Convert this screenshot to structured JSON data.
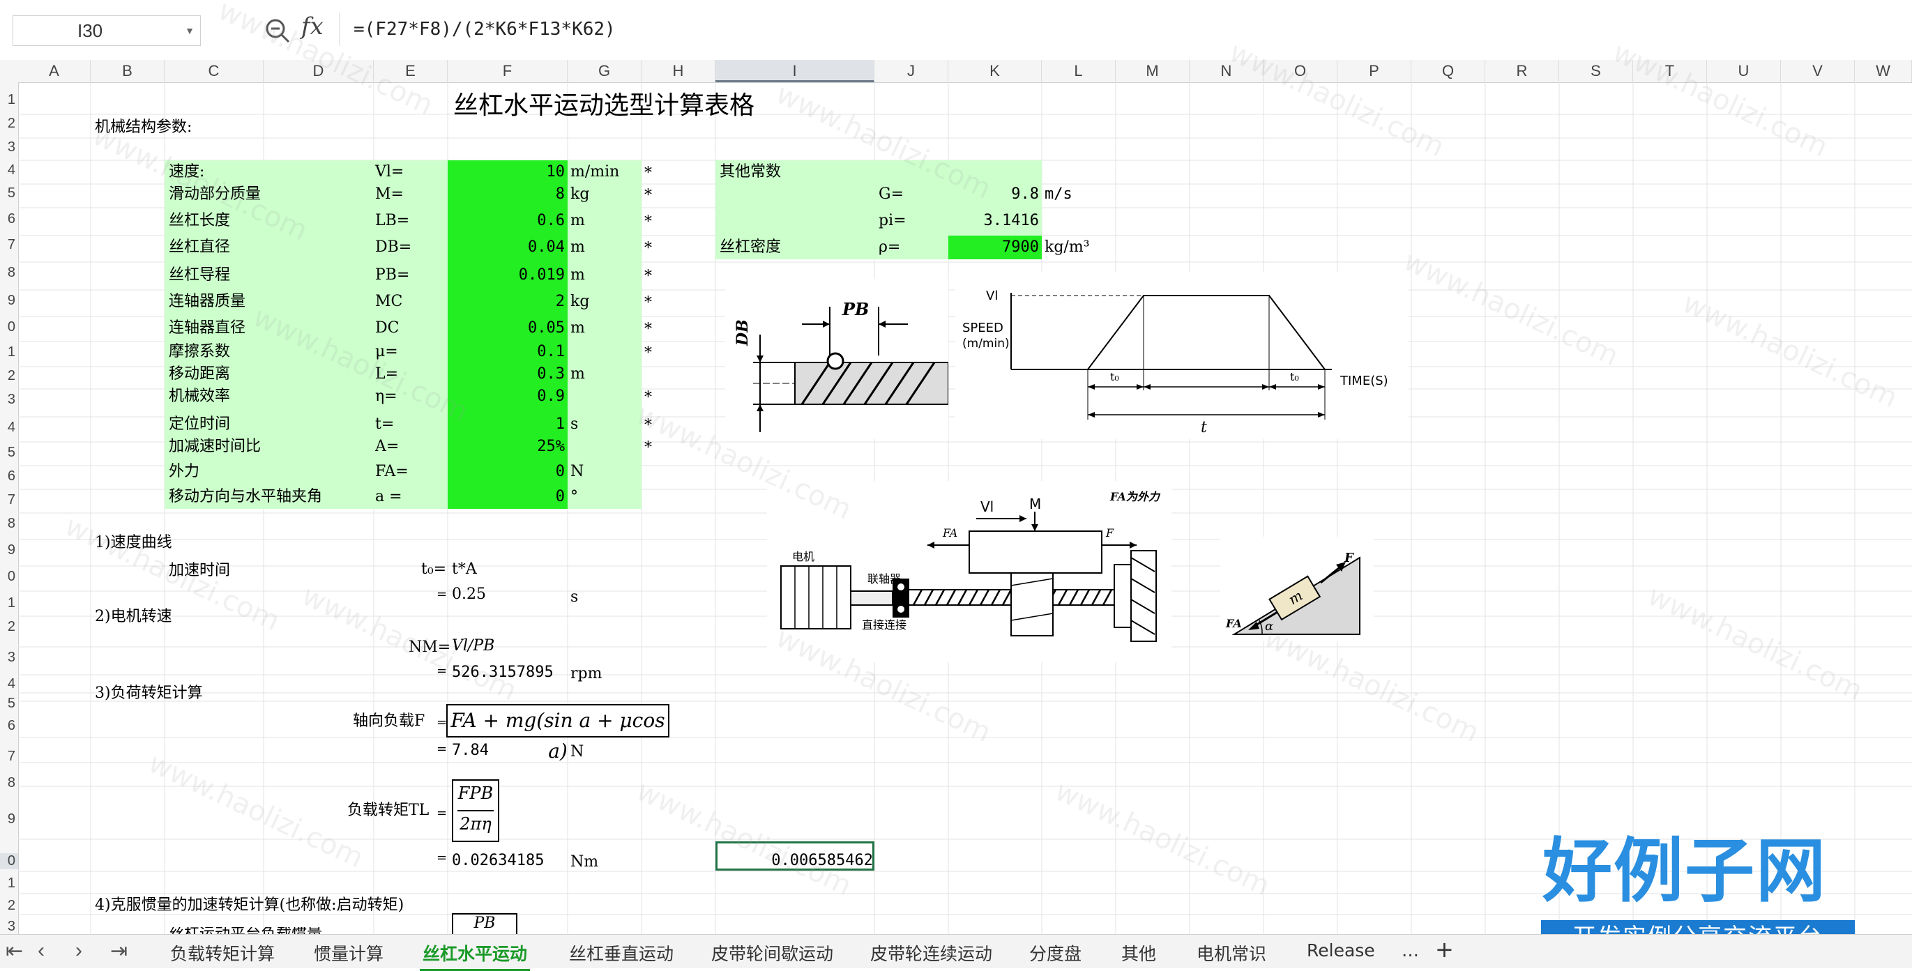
{
  "formula_bar": {
    "name_box": "I30",
    "fx_label": "fx",
    "formula": "=(F27*F8)/(2*K6*F13*K62)"
  },
  "columns": [
    "A",
    "B",
    "C",
    "D",
    "E",
    "F",
    "G",
    "H",
    "I",
    "J",
    "K",
    "L",
    "M",
    "N",
    "O",
    "P",
    "Q",
    "R",
    "S",
    "T",
    "U",
    "V",
    "W"
  ],
  "rows": [
    "1",
    "2",
    "3",
    "4",
    "5",
    "6",
    "7",
    "8",
    "9",
    "0",
    "1",
    "2",
    "3",
    "4",
    "5",
    "6",
    "7",
    "8",
    "9",
    "0",
    "1",
    "2",
    "3",
    "4",
    "5",
    "6",
    "7",
    "8",
    "9",
    "0",
    "1",
    "2",
    "3"
  ],
  "sheet": {
    "title": "丝杠水平运动选型计算表格",
    "mech_params_label": "机械结构参数:",
    "params": [
      {
        "label": "速度:",
        "sym": "Vl=",
        "val": "10",
        "unit": "m/min",
        "star": "*"
      },
      {
        "label": "滑动部分质量",
        "sym": "M=",
        "val": "8",
        "unit": "kg",
        "star": "*"
      },
      {
        "label": "丝杠长度",
        "sym": "LB=",
        "val": "0.6",
        "unit": "m",
        "star": "*"
      },
      {
        "label": "丝杠直径",
        "sym": "DB=",
        "val": "0.04",
        "unit": "m",
        "star": "*"
      },
      {
        "label": "丝杠导程",
        "sym": "PB=",
        "val": "0.019",
        "unit": "m",
        "star": "*"
      },
      {
        "label": "连轴器质量",
        "sym": "MC",
        "val": "2",
        "unit": "kg",
        "star": "*"
      },
      {
        "label": "连轴器直径",
        "sym": "DC",
        "val": "0.05",
        "unit": "m",
        "star": "*"
      },
      {
        "label": "摩擦系数",
        "sym": "μ=",
        "val": "0.1",
        "unit": "",
        "star": "*"
      },
      {
        "label": "移动距离",
        "sym": "L=",
        "val": "0.3",
        "unit": "m",
        "star": ""
      },
      {
        "label": "机械效率",
        "sym": "η=",
        "val": "0.9",
        "unit": "",
        "star": "*"
      },
      {
        "label": "定位时间",
        "sym": "t=",
        "val": "1",
        "unit": "s",
        "star": "*"
      },
      {
        "label": "加减速时间比",
        "sym": "A=",
        "val": "25%",
        "unit": "",
        "star": "*"
      },
      {
        "label": "外力",
        "sym": "FA=",
        "val": "0",
        "unit": "N",
        "star": ""
      },
      {
        "label": "移动方向与水平轴夹角",
        "sym": "a =",
        "val": "0",
        "unit": "°",
        "star": ""
      }
    ],
    "other_consts": {
      "title": "其他常数",
      "g_sym": "G=",
      "g_val": "9.8",
      "g_unit": "m/s",
      "pi_sym": "pi=",
      "pi_val": "3.1416",
      "rho_label": "丝杠密度",
      "rho_sym": "ρ=",
      "rho_val": "7900",
      "rho_unit": "kg/m³"
    },
    "sec1": {
      "title": "1)速度曲线",
      "accel_label": "加速时间",
      "t0_sym": "t₀=",
      "t0_formula": "t*A",
      "eq": "=",
      "t0_val": "0.25",
      "t0_unit": "s"
    },
    "sec2": {
      "title": "2)电机转速",
      "nm_sym": "NM=",
      "nm_formula": "Vl/PB",
      "eq": "=",
      "nm_val": "526.3157895",
      "nm_unit": "rpm"
    },
    "sec3": {
      "title": "3)负荷转矩计算",
      "axial_label": "轴向负载F",
      "eq": "=",
      "axial_formula": "FA + mg(sin a + μcos a)",
      "axial_val": "7.84",
      "axial_unit": "N",
      "torque_label": "负载转矩TL",
      "torque_formula_num": "FPB",
      "torque_formula_den": "2πη",
      "torque_val": "0.02634185",
      "torque_unit": "Nm",
      "selected_val": "0.006585462"
    },
    "sec4": {
      "title": "4)克服惯量的加速转矩计算(也称做:启动转矩)",
      "next_label": "丝杠运动平台负载惯量",
      "next_formula": "PB"
    }
  },
  "diagram_labels": {
    "pb": "PB",
    "db": "DB",
    "vl": "Vl",
    "speed": "SPEED",
    "speed_unit": "(m/min)",
    "t0": "t₀",
    "time": "TIME(S)",
    "t": "t",
    "motor": "电机",
    "coupling": "联轴器",
    "direct": "直接连接",
    "fa_ext": "FA为外力",
    "vl2": "Vl",
    "m": "M",
    "fa": "FA",
    "f": "F",
    "m_block": "m",
    "f2": "F",
    "alpha": "α"
  },
  "tabs": [
    "负载转矩计算",
    "惯量计算",
    "丝杠水平运动",
    "丝杠垂直运动",
    "皮带轮间歇运动",
    "皮带轮连续运动",
    "分度盘",
    "其他",
    "电机常识",
    "Release",
    "…",
    "+"
  ],
  "active_tab": "丝杠水平运动",
  "watermark": "www.haolizi.com",
  "logo": {
    "main": "好例子网",
    "sub": "开发实例分享交流平台"
  },
  "colors": {
    "light_green": "#ccffcc",
    "bright_green": "#22ee22",
    "active_tab": "#1a9a28",
    "logo_blue": "#2a8fe0"
  }
}
